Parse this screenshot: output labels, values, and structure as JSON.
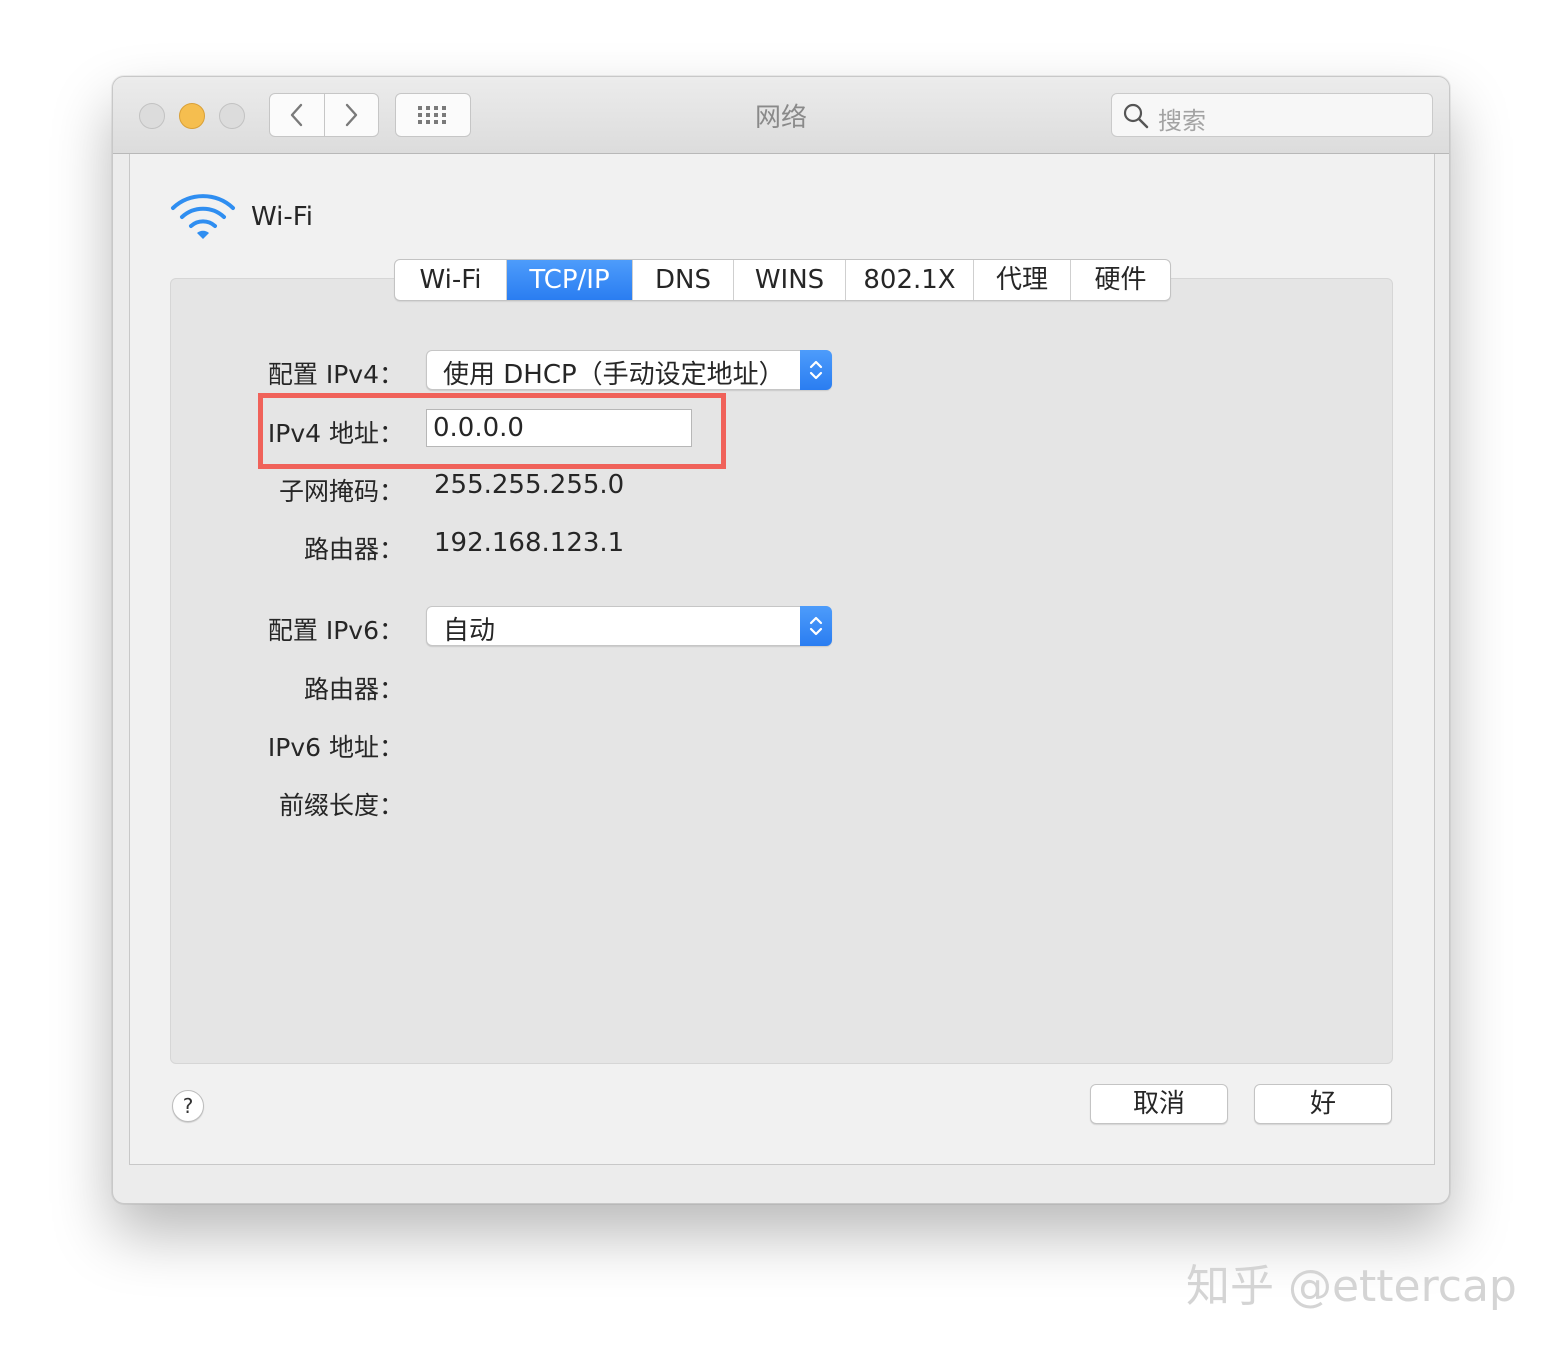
{
  "window": {
    "title": "网络",
    "search_placeholder": "搜索"
  },
  "service": {
    "name": "Wi-Fi"
  },
  "tabs": [
    {
      "label": "Wi-Fi",
      "active": false
    },
    {
      "label": "TCP/IP",
      "active": true
    },
    {
      "label": "DNS",
      "active": false
    },
    {
      "label": "WINS",
      "active": false
    },
    {
      "label": "802.1X",
      "active": false
    },
    {
      "label": "代理",
      "active": false
    },
    {
      "label": "硬件",
      "active": false
    }
  ],
  "ipv4": {
    "config_label": "配置 IPv4：",
    "config_value": "使用 DHCP（手动设定地址）",
    "address_label": "IPv4 地址：",
    "address_value": "0.0.0.0",
    "subnet_label": "子网掩码：",
    "subnet_value": "255.255.255.0",
    "router_label": "路由器：",
    "router_value": "192.168.123.1"
  },
  "ipv6": {
    "config_label": "配置 IPv6：",
    "config_value": "自动",
    "router_label": "路由器：",
    "address_label": "IPv6 地址：",
    "prefix_label": "前缀长度："
  },
  "buttons": {
    "help": "?",
    "cancel": "取消",
    "ok": "好"
  },
  "watermark": "知乎 @ettercap",
  "colors": {
    "accent": "#2a7df1",
    "highlight_box": "#f0625a",
    "minimize_light": "#f5be4f"
  }
}
